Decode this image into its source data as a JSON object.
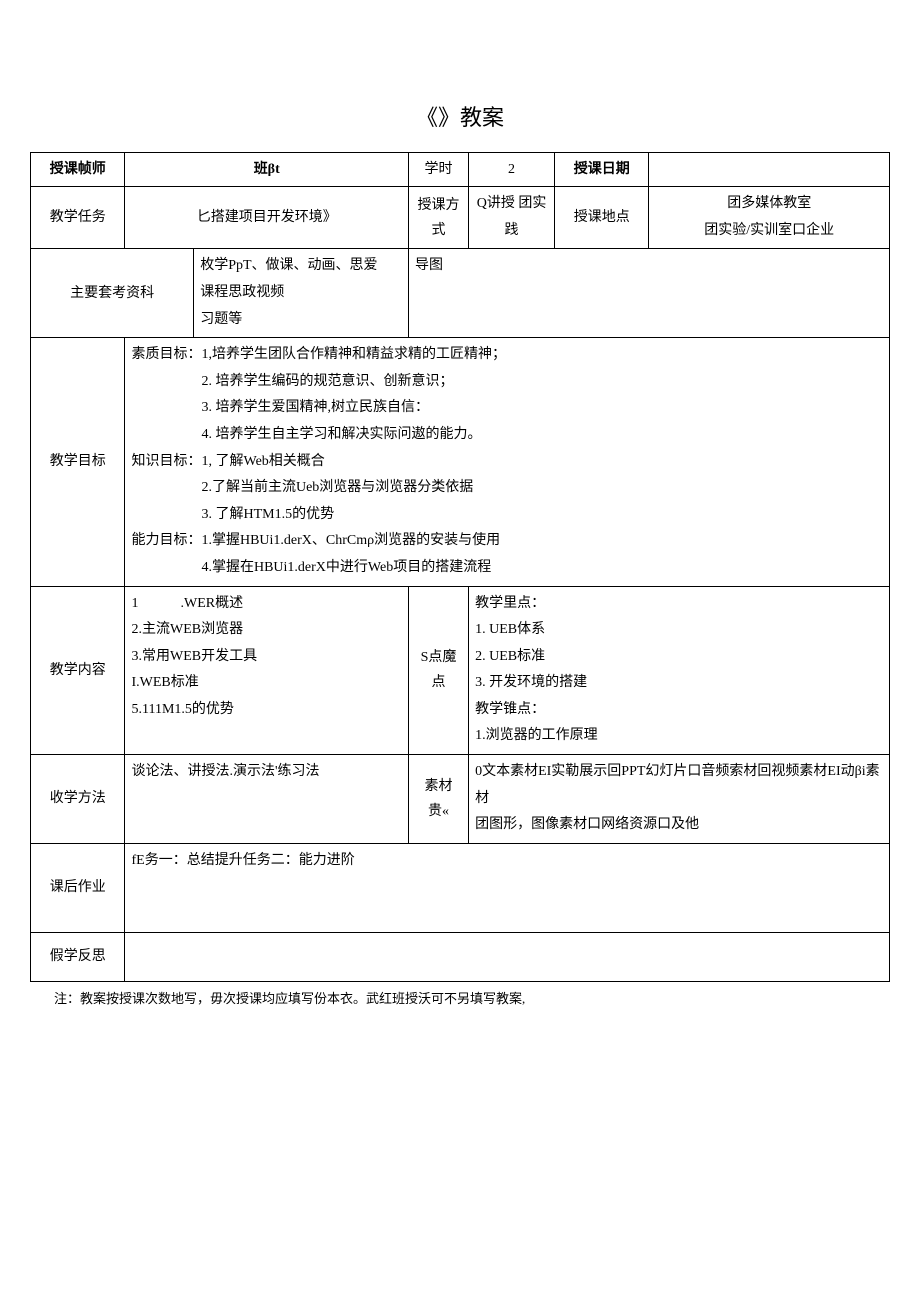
{
  "title": "《》教案",
  "row1": {
    "teacher_label": "授课帧师",
    "class_label": "班βt",
    "hours_label": "学时",
    "hours_value": "2",
    "date_label": "授课日期"
  },
  "row2": {
    "task_label": "教学任务",
    "task_value": "匕搭建项目开发环境》",
    "mode_label": "授课方式",
    "mode_value": "Q讲授 团实践",
    "place_label": "授课地点",
    "place_value": "团多媒体教室\n团实验/实训室口企业"
  },
  "row3": {
    "ref_label": "主要套考资科",
    "ref_value": "枚学PpT、做课、动画、思爱\n课程思政视频\n习题等",
    "ref_right": "导图"
  },
  "goals": {
    "label": "教学目标",
    "text": "素质目标：1,培养学生团队合作精神和精益求精的工匠精神；\n　　　　　2. 培养学生编码的规范意识、创新意识；\n　　　　　3. 培养学生爱国精神,树立民族自信：\n　　　　　4. 培养学生自主学习和解决实际问遨的能力。\n知识目标：1, 了解Web相关概合\n　　　　　2.了解当前主流Ueb浏览器与浏览器分类依据\n　　　　　3. 了解HTM1.5的优势\n能力目标：1.掌握HBUi1.derX、ChrCmρ浏览器的安装与使用\n　　　　　4.掌握在HBUi1.derX中进行Web项目的搭建流程"
  },
  "content": {
    "label": "教学内容",
    "left": "1　　　.WER概述\n2.主流WEB浏览器\n3.常用WEB开发工具\nI.WEB标准\n5.111M1.5的优势",
    "mid_label": "S点魔点",
    "right": "教学里点：\n1. UEB体系\n2. UEB标准\n3. 开发环境的搭建\n教学锥点：\n1.浏览器的工作原理"
  },
  "method": {
    "label": "收学方法",
    "value": "谈论法、讲授法.演示法'练习法",
    "mid_label": "素材贵«",
    "right": "0文本素材EI实勒展示回PPT幻灯片口音频索材回视频素材EI动βi素材\n团图形，图像素材口网络资源口及他"
  },
  "homework": {
    "label": "课后作业",
    "value": "fE务一：总结提升任务二：能力进阶"
  },
  "reflect": {
    "label": "假学反思"
  },
  "footer": "注：教案按授课次数地写，毋次授课均应填写份本衣。武红班授沃可不另填写教案,"
}
